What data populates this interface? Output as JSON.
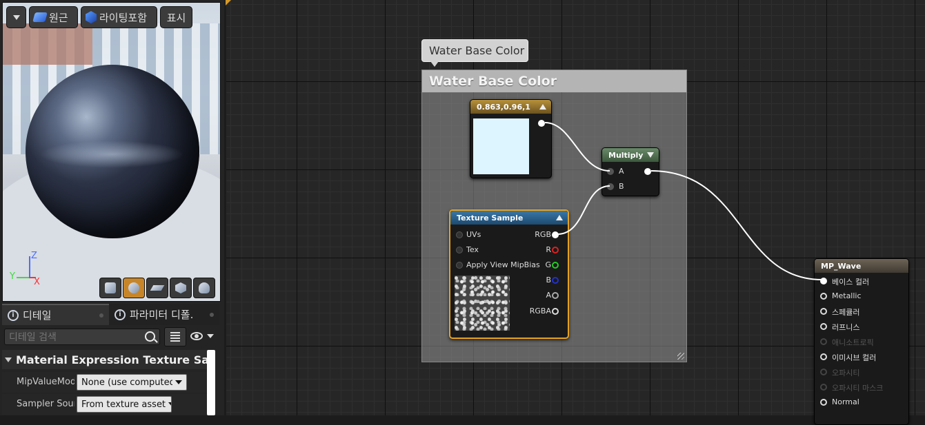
{
  "viewport": {
    "buttons": {
      "original": "원근",
      "lit": "라이팅포함",
      "show": "표시"
    },
    "axes": {
      "z": "Z",
      "y": "Y",
      "x": "X"
    },
    "preview_shapes": [
      "cylinder-icon",
      "sphere-icon",
      "plane-icon",
      "cube-icon",
      "teapot-icon"
    ]
  },
  "details": {
    "tabs": [
      {
        "label": "디테일"
      },
      {
        "label": "파라미터 디폴."
      }
    ],
    "search_placeholder": "디테일 검색",
    "category": "Material Expression Texture Sample",
    "properties": [
      {
        "label": "MipValueMode",
        "value": "None (use computed n"
      },
      {
        "label": "Sampler Source",
        "value": "From texture asset"
      }
    ]
  },
  "graph": {
    "comment": {
      "bubble": "Water Base Color",
      "title": "Water Base Color"
    },
    "const_node": {
      "title": "0.863,0.96,1",
      "color": "#dcf5ff"
    },
    "multiply_node": {
      "title": "Multiply",
      "inputs": [
        "A",
        "B"
      ]
    },
    "texture_node": {
      "title": "Texture Sample",
      "inputs": [
        "UVs",
        "Tex",
        "Apply View MipBias"
      ],
      "outputs": [
        "RGB",
        "R",
        "G",
        "B",
        "A",
        "RGBA"
      ]
    },
    "material_node": {
      "title": "MP_Wave",
      "inputs": [
        "베이스 컬러",
        "Metallic",
        "스페큘러",
        "러프니스",
        "애니소트로픽",
        "이미시브 컬러",
        "오파시티",
        "오파시티 마스크",
        "Normal"
      ]
    }
  },
  "colors": {
    "accent": "#e8a21e",
    "wire": "#ffffff"
  }
}
